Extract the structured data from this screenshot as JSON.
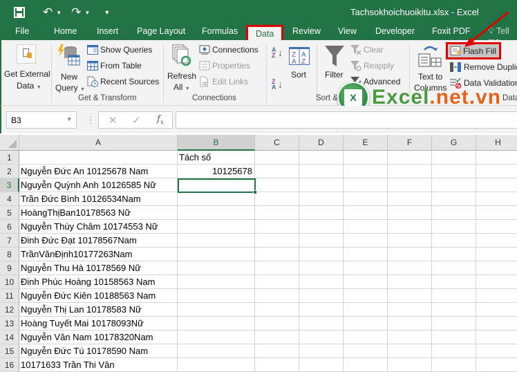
{
  "window": {
    "title": "Tachsokhoichuoikitu.xlsx - Excel"
  },
  "qat": {
    "save": "save-icon",
    "undo": "undo-icon",
    "redo": "redo-icon",
    "customize": "customize-icon"
  },
  "tabs": [
    {
      "label": "File"
    },
    {
      "label": "Home"
    },
    {
      "label": "Insert"
    },
    {
      "label": "Page Layout"
    },
    {
      "label": "Formulas"
    },
    {
      "label": "Data"
    },
    {
      "label": "Review"
    },
    {
      "label": "View"
    },
    {
      "label": "Developer"
    },
    {
      "label": "Foxit PDF"
    },
    {
      "label": "Tell me"
    }
  ],
  "active_tab": "Data",
  "ribbon": {
    "get_external": {
      "line1": "Get External",
      "line2": "Data"
    },
    "new_query": {
      "line1": "New",
      "line2": "Query"
    },
    "show_queries": "Show Queries",
    "from_table": "From Table",
    "recent_sources": "Recent Sources",
    "get_transform_label": "Get & Transform",
    "refresh": {
      "line1": "Refresh",
      "line2": "All"
    },
    "connections": "Connections",
    "properties": "Properties",
    "edit_links": "Edit Links",
    "connections_label": "Connections",
    "sort": "Sort",
    "sort_label": "Sort &",
    "filter": "Filter",
    "clear": "Clear",
    "reapply": "Reapply",
    "advanced": "Advanced",
    "text_to_columns": {
      "line1": "Text to",
      "line2": "Columns"
    },
    "flash_fill": "Flash Fill",
    "remove_duplicates": "Remove Duplic",
    "data_validation": "Data Validation",
    "data_tools_label": "Data"
  },
  "watermark": {
    "part1": "Excel",
    "part2": ".net.vn"
  },
  "formula_bar": {
    "name_box": "B3",
    "formula": ""
  },
  "columns": [
    "A",
    "B",
    "C",
    "D",
    "E",
    "F",
    "G",
    "H"
  ],
  "selected_cell": "B3",
  "rows": [
    {
      "n": "1",
      "a": "",
      "b": "Tách số"
    },
    {
      "n": "2",
      "a": "Nguyễn Đức An 10125678 Nam",
      "b": "10125678"
    },
    {
      "n": "3",
      "a": "Nguyễn Quỳnh Anh 10126585 Nữ",
      "b": ""
    },
    {
      "n": "4",
      "a": "Trần Đức Bình 10126534Nam",
      "b": ""
    },
    {
      "n": "5",
      "a": "HoàngThịBan10178563 Nữ",
      "b": ""
    },
    {
      "n": "6",
      "a": "Nguyễn Thùy Châm 10174553 Nữ",
      "b": ""
    },
    {
      "n": "7",
      "a": "Đinh Đức Đạt 10178567Nam",
      "b": ""
    },
    {
      "n": "8",
      "a": "TrầnVănĐịnh10177263Nam",
      "b": ""
    },
    {
      "n": "9",
      "a": "Nguyễn Thu Hà 10178569 Nữ",
      "b": ""
    },
    {
      "n": "10",
      "a": "Đinh Phúc Hoàng 10158563 Nam",
      "b": ""
    },
    {
      "n": "11",
      "a": "Nguyễn Đức Kiên 10188563 Nam",
      "b": ""
    },
    {
      "n": "12",
      "a": "Nguyễn Thị Lan 10178583 Nữ",
      "b": ""
    },
    {
      "n": "13",
      "a": "Hoàng Tuyết Mai 10178093Nữ",
      "b": ""
    },
    {
      "n": "14",
      "a": "Nguyễn Văn Nam 10178320Nam",
      "b": ""
    },
    {
      "n": "15",
      "a": "Nguyễn Đức Tú 10178590 Nam",
      "b": ""
    },
    {
      "n": "16",
      "a": " 10171633 Trần Thi Vân",
      "b": ""
    }
  ],
  "colors": {
    "excel_green": "#217346",
    "highlight_red": "#e00000",
    "watermark_orange": "#e8621a"
  }
}
